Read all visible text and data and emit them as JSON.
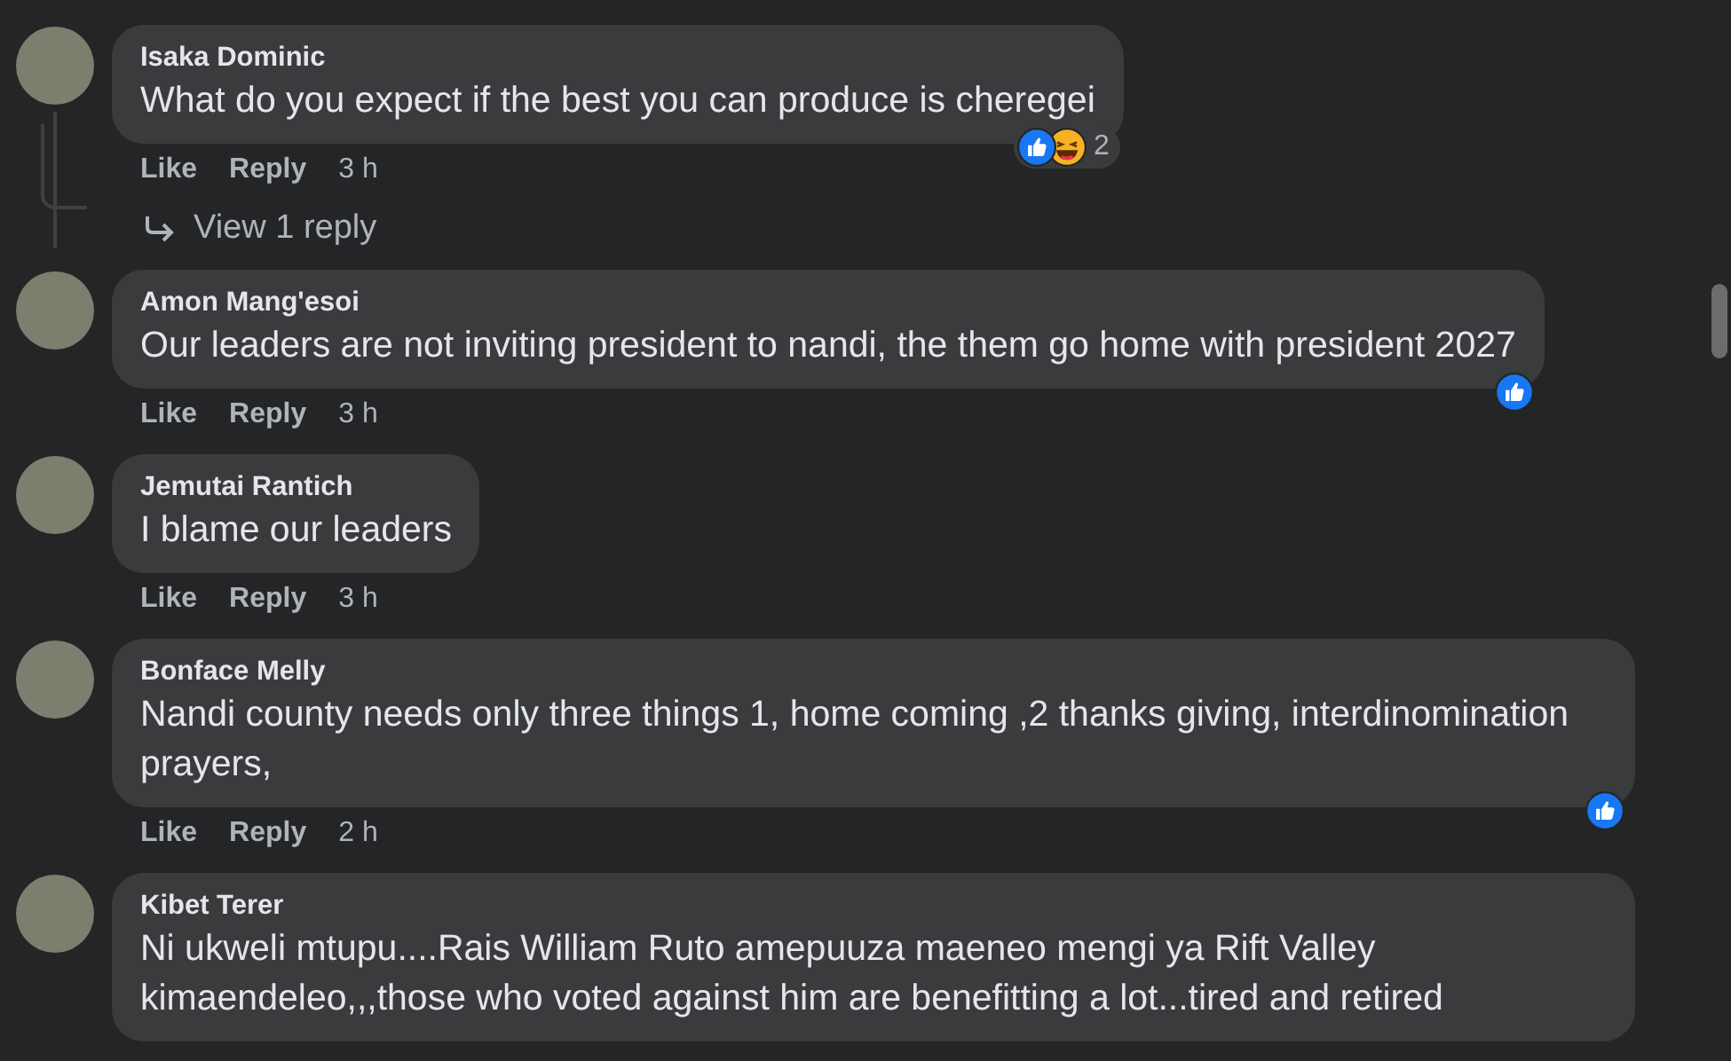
{
  "comments": [
    {
      "author": "Isaka Dominic",
      "text": "What do you expect if the best you can produce is cheregei",
      "reactions": [
        {
          "kind": "like"
        },
        {
          "kind": "haha"
        }
      ],
      "reaction_count": "2",
      "actions": [
        "Like",
        "Reply"
      ],
      "time": "3 h",
      "replies_link": "View 1 reply"
    },
    {
      "author": "Amon Mang'esoi",
      "text": "Our leaders are not inviting president to nandi, the them go home with president 2027",
      "reactions": [
        {
          "kind": "like"
        }
      ],
      "actions": [
        "Like",
        "Reply"
      ],
      "time": "3 h"
    },
    {
      "author": "Jemutai Rantich",
      "text": "I blame our leaders",
      "actions": [
        "Like",
        "Reply"
      ],
      "time": "3 h"
    },
    {
      "author": "Bonface Melly",
      "text": "Nandi county needs only three things 1, home coming ,2 thanks giving, interdinomination prayers,",
      "reactions": [
        {
          "kind": "like"
        }
      ],
      "actions": [
        "Like",
        "Reply"
      ],
      "time": "2 h"
    },
    {
      "author": "Kibet Terer",
      "text": "Ni ukweli mtupu....Rais William Ruto amepuuza maeneo mengi ya Rift Valley kimaendeleo,,,those who voted against him are benefitting a lot...tired and retired"
    }
  ]
}
